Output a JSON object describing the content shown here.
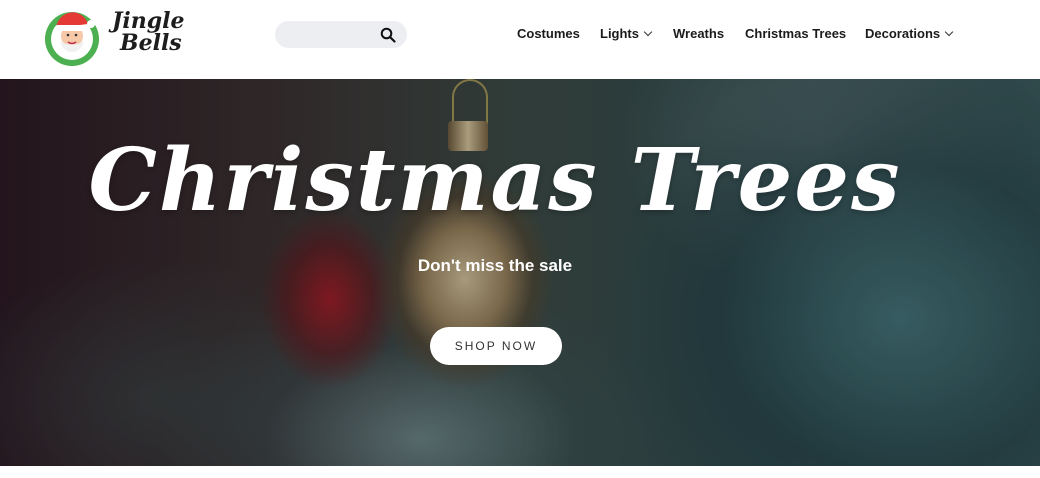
{
  "brand": {
    "name_line1": "Jingle",
    "name_line2": "Bells",
    "logo_icon": "santa-icon",
    "accent_color": "#4caf50"
  },
  "search": {
    "placeholder": "",
    "value": "",
    "icon": "search-icon"
  },
  "nav": {
    "items": [
      {
        "label": "Costumes",
        "has_dropdown": false
      },
      {
        "label": "Lights",
        "has_dropdown": true
      },
      {
        "label": "Wreaths",
        "has_dropdown": false
      },
      {
        "label": "Christmas Trees",
        "has_dropdown": false
      },
      {
        "label": "Decorations",
        "has_dropdown": true
      }
    ]
  },
  "hero": {
    "title": "Christmas Trees",
    "subtitle": "Don't miss the sale",
    "cta_label": "SHOP NOW"
  }
}
